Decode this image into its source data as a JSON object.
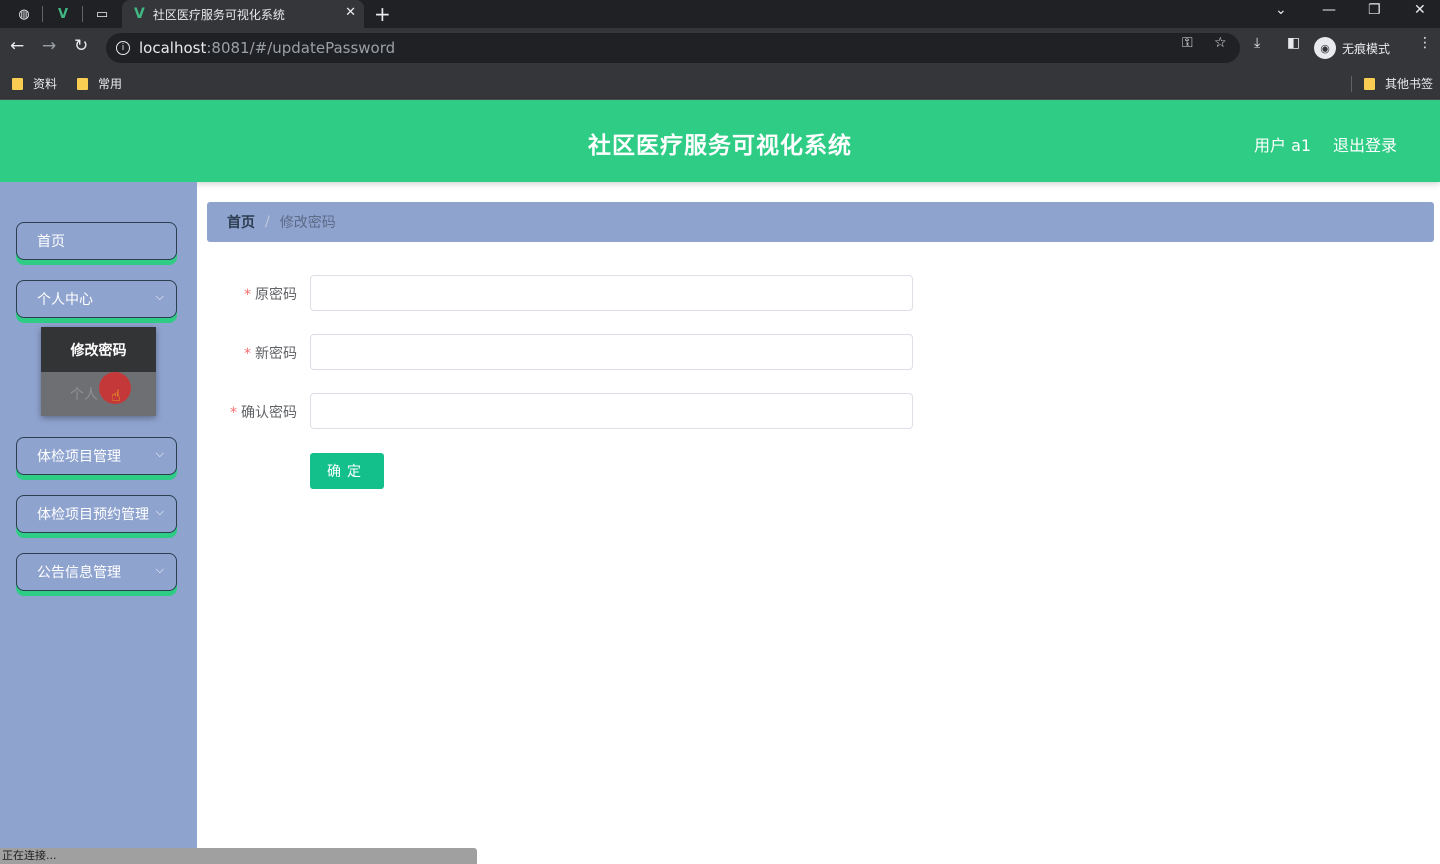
{
  "browser": {
    "tab_title": "社区医疗服务可视化系统",
    "url_host": "localhost",
    "url_path": ":8081/#/updatePassword",
    "incognito_label": "无痕模式",
    "bookmarks": [
      "资料",
      "常用"
    ],
    "other_bookmarks": "其他书签",
    "status_text": "正在连接..."
  },
  "header": {
    "title": "社区医疗服务可视化系统",
    "user_label": "用户 a1",
    "logout_label": "退出登录"
  },
  "sidebar": {
    "items": [
      {
        "label": "首页"
      },
      {
        "label": "个人中心"
      },
      {
        "label": "体检项目管理"
      },
      {
        "label": "体检项目预约管理"
      },
      {
        "label": "公告信息管理"
      }
    ],
    "submenu": [
      "修改密码",
      "个人信息"
    ],
    "submenu_visible_text": "个人"
  },
  "breadcrumb": {
    "home": "首页",
    "separator": "/",
    "current": "修改密码"
  },
  "form": {
    "fields": [
      {
        "label": "原密码",
        "value": ""
      },
      {
        "label": "新密码",
        "value": ""
      },
      {
        "label": "确认密码",
        "value": ""
      }
    ],
    "required_mark": "*",
    "submit_label": "确定"
  },
  "colors": {
    "header_bg": "#2ecc84",
    "sidebar_bg": "#8fa3cf",
    "submit_bg": "#13c08c"
  }
}
